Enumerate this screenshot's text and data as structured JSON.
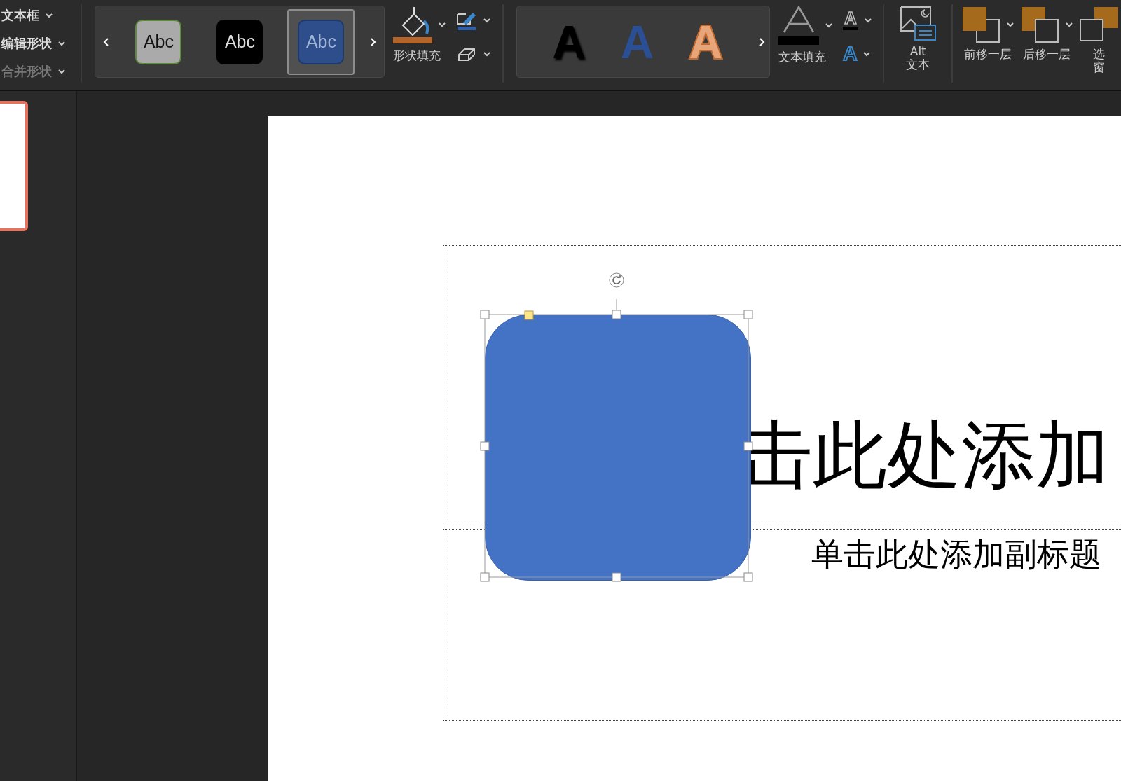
{
  "ribbon": {
    "shape_menu": [
      {
        "label": "文本框",
        "disabled": false
      },
      {
        "label": "编辑形状",
        "disabled": false
      },
      {
        "label": "合并形状",
        "disabled": true
      }
    ],
    "shape_styles": [
      {
        "label": "Abc",
        "kind": "gray",
        "selected": false
      },
      {
        "label": "Abc",
        "kind": "black",
        "selected": false
      },
      {
        "label": "Abc",
        "kind": "blue",
        "selected": true
      }
    ],
    "shape_fill": {
      "label": "形状填充"
    },
    "wordart_styles": [
      {
        "label": "A",
        "kind": "black"
      },
      {
        "label": "A",
        "kind": "blue"
      },
      {
        "label": "A",
        "kind": "orange"
      }
    ],
    "text_fill": {
      "label": "文本填充"
    },
    "text_outline": {
      "glyph": "A"
    },
    "text_effects": {
      "glyph": "A"
    },
    "alt_text": {
      "lines": [
        "Alt",
        "文本"
      ]
    },
    "arrange": [
      {
        "kind": "forward",
        "lines": [
          "前移一层"
        ]
      },
      {
        "kind": "backward",
        "lines": [
          "后移一层"
        ]
      },
      {
        "kind": "pane",
        "lines": [
          "选",
          "窗"
        ]
      }
    ]
  },
  "thumbnails": [
    {
      "selected": true
    }
  ],
  "slide": {
    "title": "击此处添加",
    "subtitle": "单击此处添加副标题"
  }
}
